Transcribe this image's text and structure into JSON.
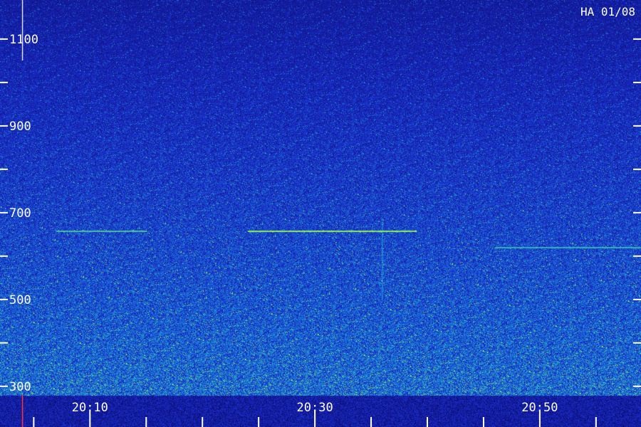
{
  "chart_data": {
    "type": "heatmap",
    "station_label": "HA 01/08",
    "y_axis": {
      "ylim": [
        280,
        1190
      ],
      "ticks": [
        300,
        400,
        500,
        600,
        700,
        800,
        900,
        1000,
        1100
      ],
      "tick_labels": [
        "300",
        "",
        "500",
        "",
        "700",
        "",
        "900",
        "",
        "1100"
      ]
    },
    "x_axis": {
      "xlim": [
        "20:02",
        "20:59"
      ],
      "major_ticks": [
        "20:10",
        "20:30",
        "20:50"
      ],
      "tick_labels": [
        "20:10",
        "20:30",
        "20:50"
      ],
      "minor_tick_step_minutes": 5
    },
    "features": [
      {
        "kind": "horizontal_trace",
        "name": "",
        "from": "20:07",
        "to": "20:15",
        "y": 658,
        "intensity": 0.7
      },
      {
        "kind": "horizontal_trace",
        "name": "",
        "from": "20:24",
        "to": "20:39",
        "y": 658,
        "intensity": 1.0
      },
      {
        "kind": "horizontal_trace",
        "name": "",
        "from": "20:46",
        "to": "20:59",
        "y": 620,
        "intensity": 0.6
      },
      {
        "kind": "vertical_burst",
        "at": "20:36",
        "y_range": [
          500,
          680
        ],
        "intensity": 0.7
      }
    ],
    "colors": {
      "background": "#0b0b6e",
      "low": "#1b2fd0",
      "mid": "#1aa0d8",
      "high": "#a8ff3a",
      "axis": "#ffffff",
      "marker": "#ff3030"
    },
    "cursor_marker_time": "20:04"
  }
}
